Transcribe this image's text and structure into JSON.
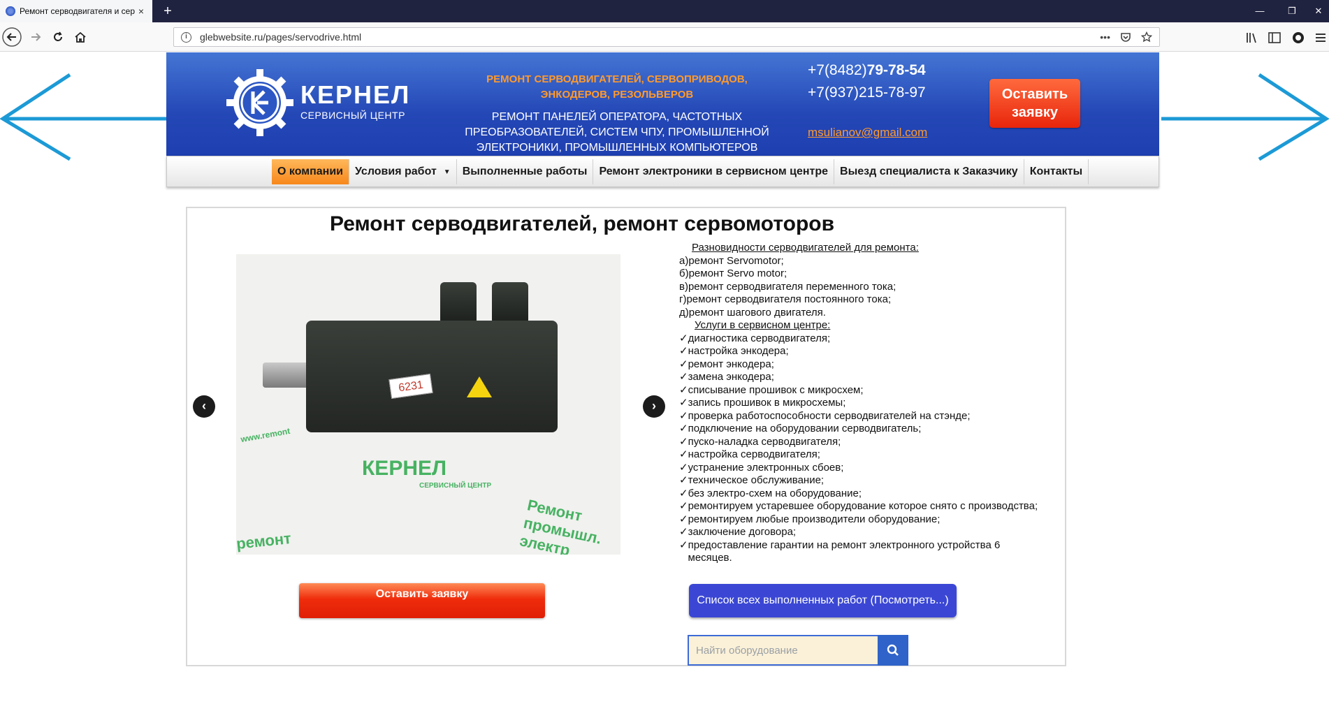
{
  "browser": {
    "tab_title": "Ремонт серводвигателя и сер",
    "tab_close": "×",
    "new_tab": "+",
    "url": "glebwebsite.ru/pages/servodrive.html",
    "url_more": "•••"
  },
  "header": {
    "logo_name": "КЕРНЕЛ",
    "logo_subtitle": "СЕРВИСНЫЙ ЦЕНТР",
    "tagline_orange": "РЕМОНТ СЕРВОДВИГАТЕЛЕЙ, СЕРВОПРИВОДОВ, ЭНКОДЕРОВ, РЕЗОЛЬВЕРОВ",
    "tagline_white": "РЕМОНТ ПАНЕЛЕЙ ОПЕРАТОРА, ЧАСТОТНЫХ ПРЕОБРАЗОВАТЕЛЕЙ, СИСТЕМ ЧПУ, ПРОМЫШЛЕННОЙ ЭЛЕКТРОНИКИ, ПРОМЫШЛЕННЫХ КОМПЬЮТЕРОВ",
    "phone1_prefix": "+7(8482)",
    "phone1_number": "79-78-54",
    "phone2": "+7(937)215-78-97",
    "email": "msulianov@gmail.com",
    "cta_label": "Оставить заявку"
  },
  "menu": {
    "items": [
      {
        "label": "О компании"
      },
      {
        "label": "Условия работ"
      },
      {
        "label": "Выполненные работы"
      },
      {
        "label": "Ремонт электроники в сервисном центре"
      },
      {
        "label": "Выезд специалиста к Заказчику"
      },
      {
        "label": "Контакты"
      }
    ]
  },
  "main": {
    "title": "Ремонт серводвигателей, ремонт сервомоторов",
    "photo_label": "6231",
    "photo_watermark_name": "КЕРНЕЛ",
    "photo_watermark_sub": "СЕРВИСНЫЙ ЦЕНТР",
    "photo_watermark_1": "Ремонт промышл. электр",
    "photo_watermark_2": "ремонт",
    "photo_watermark_3": "www.remont",
    "prev_symbol": "‹",
    "next_symbol": "›",
    "types_heading": "Разновидности серводвигателей для ремонта:",
    "types": [
      "а)ремонт Servomotor;",
      "б)ремонт Servo motor;",
      "в)ремонт серводвигателя переменного тока;",
      " г)ремонт серводвигателя постоянного тока;",
      "д)ремонт шагового двигателя."
    ],
    "services_heading": "Услуги в сервисном центре:",
    "services": [
      "✓диагностика серводвигателя;",
      "✓настройка энкодера;",
      "✓ремонт энкодера;",
      "✓замена энкодера;",
      "✓списывание прошивок с микросхем;",
      "✓запись прошивок в микросхемы;",
      "✓проверка работоспособности серводвигателей на стэнде;",
      "✓подключение на оборудовании серводвигатель;",
      "✓пуско-наладка серводвигателя;",
      "✓настройка серводвигателя;",
      "✓устранение электронных сбоев;",
      "✓техническое обслуживание;",
      "✓без электро-схем на оборудование;",
      "✓ремонтируем устаревшее оборудование которое снято с производства;",
      "✓ремонтируем любые производители оборудование;",
      "✓заключение договора;",
      "✓предоставление гарантии на ремонт электронного устройства 6",
      "   месяцев."
    ],
    "cta_label": "Оставить заявку",
    "works_button": "Список всех выполненных работ (Посмотреть...)",
    "search_placeholder": "Найти оборудование"
  },
  "colors": {
    "header_blue": "#2447b6",
    "accent_orange": "#ff9a2e",
    "cta_red": "#e8250c",
    "button_blue": "#3b47d4"
  }
}
